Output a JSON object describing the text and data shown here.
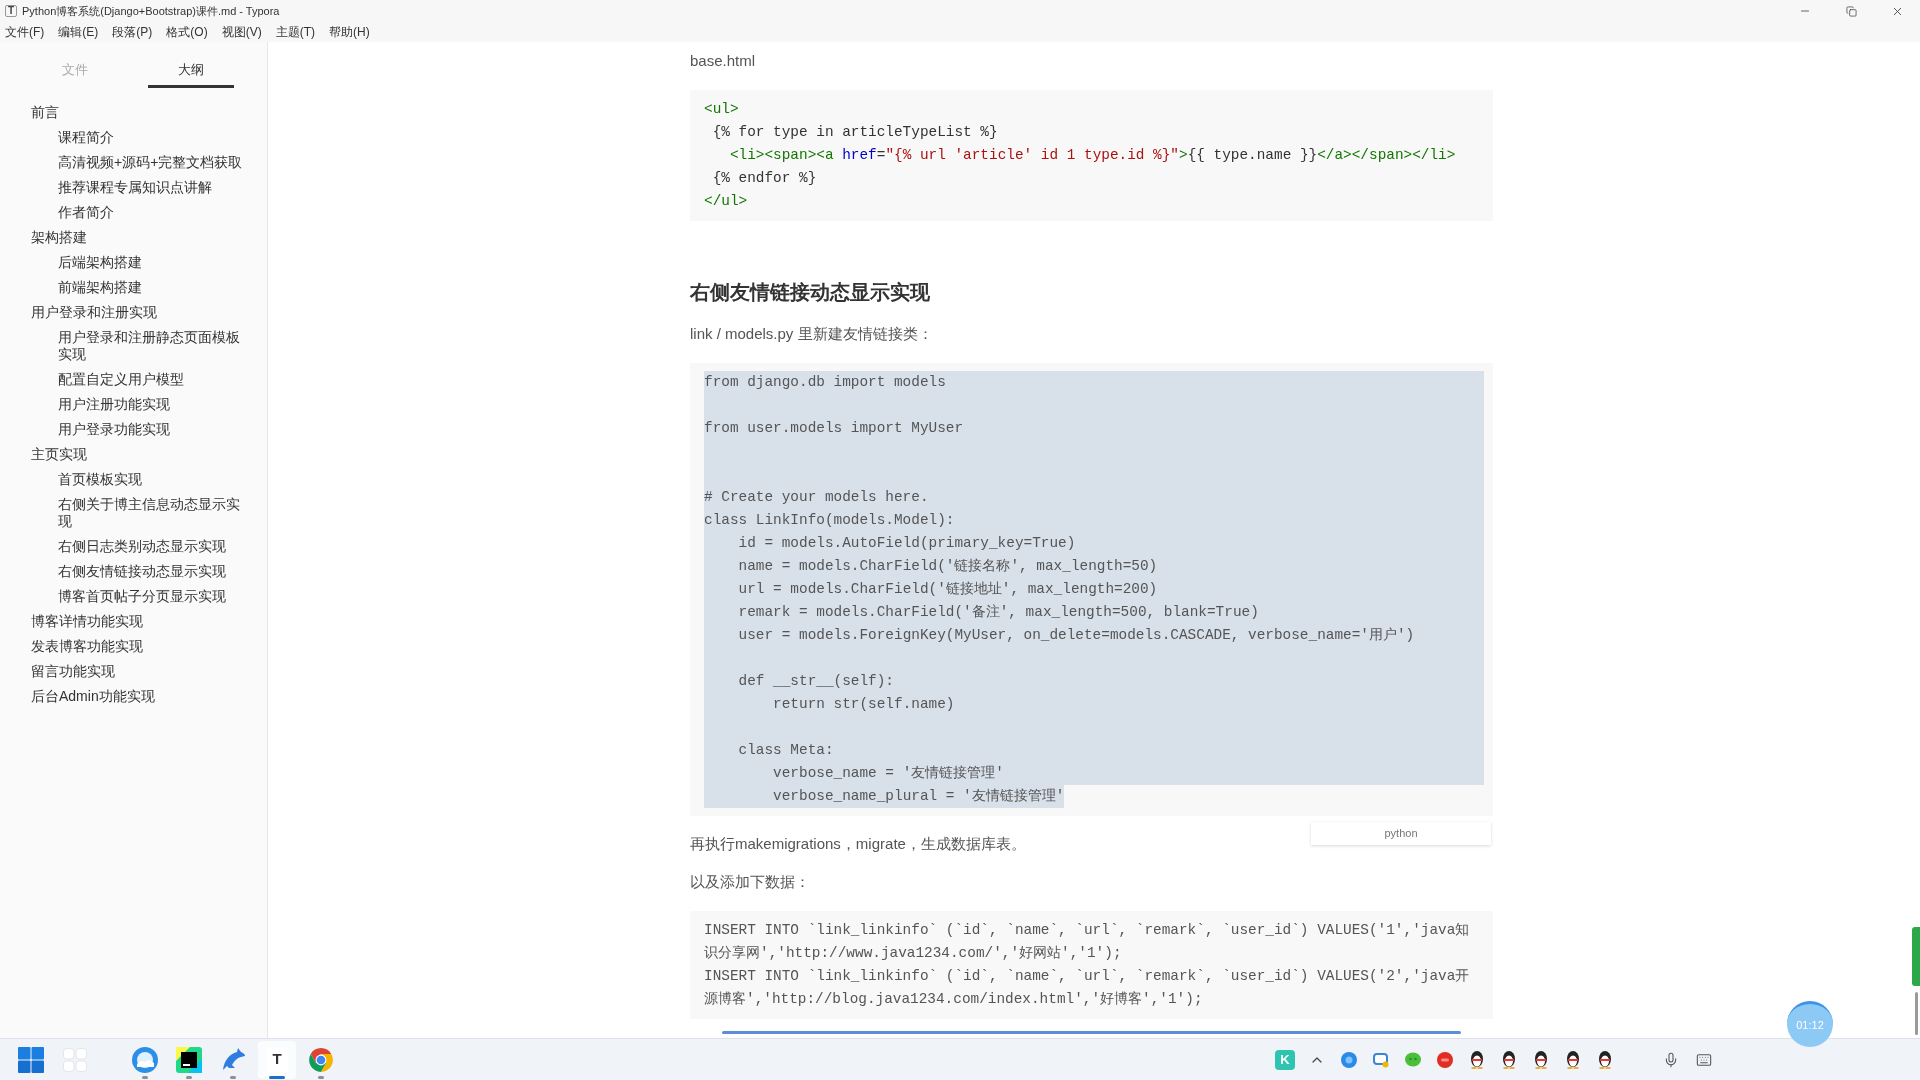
{
  "window": {
    "app_glyph": "T",
    "title": "Python博客系统(Django+Bootstrap)课件.md - Typora"
  },
  "menu": [
    "文件(F)",
    "编辑(E)",
    "段落(P)",
    "格式(O)",
    "视图(V)",
    "主题(T)",
    "帮助(H)"
  ],
  "sidebar": {
    "tabs": [
      {
        "label": "文件",
        "selected": false
      },
      {
        "label": "大纲",
        "selected": true
      }
    ],
    "outline": [
      {
        "label": "前言",
        "children": [
          {
            "label": "课程简介"
          },
          {
            "label": "高清视频+源码+完整文档获取"
          },
          {
            "label": "推荐课程专属知识点讲解"
          },
          {
            "label": "作者简介"
          }
        ]
      },
      {
        "label": "架构搭建",
        "children": [
          {
            "label": "后端架构搭建"
          },
          {
            "label": "前端架构搭建"
          }
        ]
      },
      {
        "label": "用户登录和注册实现",
        "children": [
          {
            "label": "用户登录和注册静态页面模板实现"
          },
          {
            "label": "配置自定义用户模型"
          },
          {
            "label": "用户注册功能实现"
          },
          {
            "label": "用户登录功能实现"
          }
        ]
      },
      {
        "label": "主页实现",
        "children": [
          {
            "label": "首页模板实现"
          },
          {
            "label": "右侧关于博主信息动态显示实现"
          },
          {
            "label": "右侧日志类别动态显示实现"
          },
          {
            "label": "右侧友情链接动态显示实现"
          },
          {
            "label": "博客首页帖子分页显示实现"
          }
        ]
      },
      {
        "label": "博客详情功能实现"
      },
      {
        "label": "发表博客功能实现"
      },
      {
        "label": "留言功能实现"
      },
      {
        "label": "后台Admin功能实现"
      }
    ]
  },
  "document": {
    "blocks": [
      {
        "kind": "paragraph",
        "text": "base.html"
      },
      {
        "kind": "code",
        "lines": [
          {
            "tokens": [
              {
                "text": "<ul>",
                "kind": "tag"
              }
            ]
          },
          {
            "tokens": [
              {
                "text": " {% for type in articleTypeList %}",
                "kind": "plain"
              }
            ]
          },
          {
            "tokens": [
              {
                "text": "   <li><span><a ",
                "kind": "tag"
              },
              {
                "text": "href",
                "kind": "attr"
              },
              {
                "text": "=",
                "kind": "plain"
              },
              {
                "text": "\"{% url 'article' id 1 type.id %}\"",
                "kind": "string"
              },
              {
                "text": ">",
                "kind": "tag"
              },
              {
                "text": "{{ type.name }}",
                "kind": "plain"
              },
              {
                "text": "</a></span></li>",
                "kind": "tag"
              }
            ]
          },
          {
            "tokens": [
              {
                "text": " {% endfor %}",
                "kind": "plain"
              }
            ]
          },
          {
            "tokens": [
              {
                "text": "</ul>",
                "kind": "tag"
              }
            ]
          }
        ]
      },
      {
        "kind": "heading",
        "text": "右侧友情链接动态显示实现"
      },
      {
        "kind": "paragraph",
        "text": "link / models.py 里新建友情链接类："
      },
      {
        "kind": "code",
        "selected": true,
        "language": "python",
        "code": "from django.db import models\n\nfrom user.models import MyUser\n\n\n# Create your models here.\nclass LinkInfo(models.Model):\n    id = models.AutoField(primary_key=True)\n    name = models.CharField('链接名称', max_length=50)\n    url = models.CharField('链接地址', max_length=200)\n    remark = models.CharField('备注', max_length=500, blank=True)\n    user = models.ForeignKey(MyUser, on_delete=models.CASCADE, verbose_name='用户')\n\n    def __str__(self):\n        return str(self.name)\n\n    class Meta:\n        verbose_name = '友情链接管理'\n        verbose_name_plural = '友情链接管理'"
      },
      {
        "kind": "paragraph",
        "text": "再执行makemigrations，migrate，生成数据库表。"
      },
      {
        "kind": "paragraph",
        "text": "以及添加下数据："
      },
      {
        "kind": "code",
        "code": "INSERT INTO `link_linkinfo` (`id`, `name`, `url`, `remark`, `user_id`) VALUES('1','java知识分享网','http://www.java1234.com/','好网站','1');\nINSERT INTO `link_linkinfo` (`id`, `name`, `url`, `remark`, `user_id`) VALUES('2','java开源博客','http://blog.java1234.com/index.html','好博客','1');"
      }
    ]
  },
  "recorder": {
    "time": "01:12"
  },
  "taskbar": {
    "system": [
      {
        "kind": "start"
      },
      {
        "kind": "widgets"
      }
    ],
    "apps": [
      {
        "kind": "browser",
        "running": true,
        "selected": false
      },
      {
        "kind": "ide",
        "running": true,
        "selected": false
      },
      {
        "kind": "dolphin",
        "running": true,
        "selected": false
      },
      {
        "kind": "letter",
        "glyph": "T",
        "running": true,
        "selected": true
      },
      {
        "kind": "chrome",
        "running": true,
        "selected": false
      }
    ],
    "tray": [
      {
        "kind": "letter",
        "glyph": "K"
      },
      {
        "kind": "chevron"
      },
      {
        "kind": "sphere"
      },
      {
        "kind": "bubble"
      },
      {
        "kind": "chat"
      },
      {
        "kind": "round"
      },
      {
        "kind": "penguin"
      },
      {
        "kind": "penguin"
      },
      {
        "kind": "penguin"
      },
      {
        "kind": "penguin"
      },
      {
        "kind": "penguin"
      }
    ],
    "system_tray": [
      {
        "kind": "mic"
      },
      {
        "kind": "keyboard"
      }
    ]
  }
}
